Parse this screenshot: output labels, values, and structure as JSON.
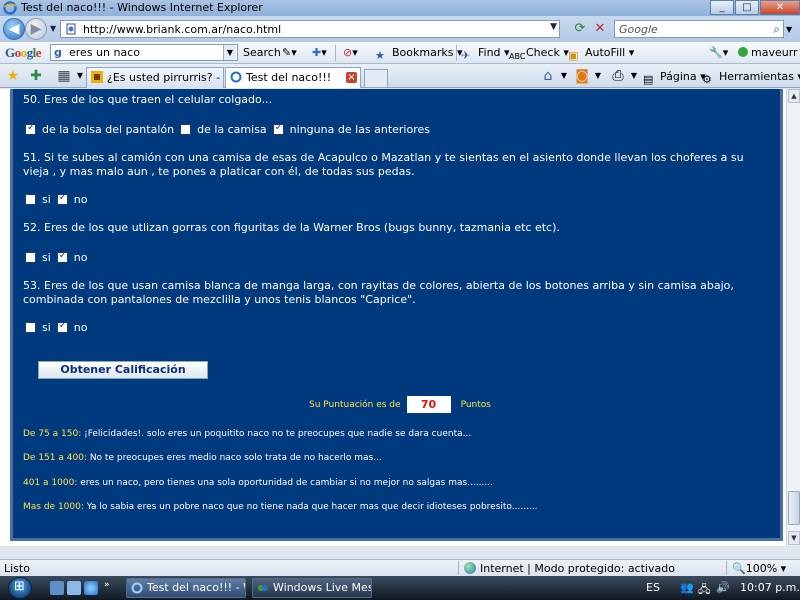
{
  "window": {
    "title": "Test del naco!!! - Windows Internet Explorer"
  },
  "address": {
    "url": "http://www.briank.com.ar/naco.html",
    "search_placeholder": "Google"
  },
  "google_toolbar": {
    "logo": [
      "G",
      "o",
      "o",
      "g",
      "l",
      "e"
    ],
    "search_value": "eres un naco",
    "search_label": "Search",
    "bookmarks_label": "Bookmarks",
    "find_label": "Find",
    "check_label": "Check",
    "autofill_label": "AutoFill",
    "user_label": "maveurr"
  },
  "tabs": [
    {
      "label": "¿Es usted pirrurris? - Foros ...",
      "active": false
    },
    {
      "label": "Test del naco!!!",
      "active": true
    }
  ],
  "command_bar": {
    "page_label": "Página",
    "tools_label": "Herramientas"
  },
  "quiz": {
    "q50": {
      "text": "50. Eres de los que traen el celular colgado...",
      "options": [
        {
          "label": "de la bolsa del pantalón",
          "checked": true
        },
        {
          "label": "de la camisa",
          "checked": false
        },
        {
          "label": "ninguna de las anteriores",
          "checked": true
        }
      ]
    },
    "q51": {
      "text": "51. Si te subes al camión con una camisa de esas de Acapulco o Mazatlan y te sientas en el asiento donde llevan los choferes a su vieja , y mas malo aun , te pones a platicar con él, de todas sus pedas.",
      "options": [
        {
          "label": "si",
          "checked": false
        },
        {
          "label": "no",
          "checked": true
        }
      ]
    },
    "q52": {
      "text": "52. Eres de los que utlizan gorras con figuritas de la Warner Bros (bugs bunny, tazmania etc etc).",
      "options": [
        {
          "label": "si",
          "checked": false
        },
        {
          "label": "no",
          "checked": true
        }
      ]
    },
    "q53": {
      "text": "53. Eres de los que usan camisa blanca de manga larga, con rayitas de colores, abierta de los botones arriba y sin camisa abajo, combinada con pantalones de mezclilla y unos tenis blancos \"Caprice\".",
      "options": [
        {
          "label": "si",
          "checked": false
        },
        {
          "label": "no",
          "checked": true
        }
      ]
    }
  },
  "result": {
    "button_label": "Obtener Calificación",
    "score_prefix": "Su Puntuación es de",
    "score_value": "70",
    "score_suffix": "Puntos",
    "ranges": [
      {
        "label": "De 75 a 150:",
        "text": " ¡Felicidades!. solo eres un poquitito naco no te preocupes que nadie se dara cuenta..."
      },
      {
        "label": "De 151 a 400:",
        "text": " No te preocupes eres medio naco solo trata de no hacerlo mas..."
      },
      {
        "label": "401 a 1000:",
        "text": " eres un naco, pero tienes una sola oportunidad de cambiar si no mejor no salgas mas........."
      },
      {
        "label": "Mas de 1000:",
        "text": " Ya lo sabia eres un pobre naco que no tiene nada que hacer mas que decir idioteses pobresito........."
      }
    ]
  },
  "status": {
    "left": "Listo",
    "zone": "Internet | Modo protegido: activado",
    "zoom": "100%"
  },
  "taskbar": {
    "tasks": [
      {
        "label": "Test del naco!!! - Wi...",
        "active": true
      },
      {
        "label": "Windows Live Mess...",
        "active": false
      }
    ],
    "lang": "ES",
    "clock": "10:07 p.m."
  },
  "colors": {
    "page_bg": "#003a7e",
    "highlight": "#ffe34d",
    "score": "#dd1111"
  }
}
